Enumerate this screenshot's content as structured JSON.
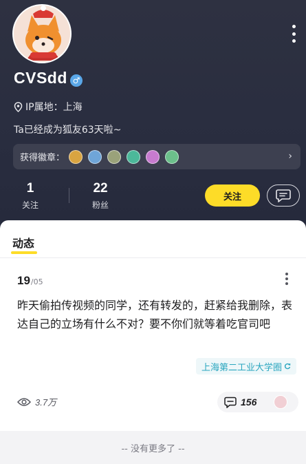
{
  "profile": {
    "avatar_alt": "fox avatar",
    "username": "CVSdd",
    "gender_icon": "♂",
    "ip_location": "IP属地：上海",
    "friend_days": "Ta已经成为狐友63天啦~",
    "badges_label": "获得徽章：",
    "badge_colors": [
      "#d9a441",
      "#6fa5d8",
      "#9aa27a",
      "#4cb89a",
      "#c77bcf",
      "#6cc08b"
    ]
  },
  "stats": {
    "following": {
      "count": "1",
      "label": "关注"
    },
    "followers": {
      "count": "22",
      "label": "粉丝"
    }
  },
  "actions": {
    "follow_label": "关注"
  },
  "tabs": {
    "active_label": "动态"
  },
  "post": {
    "day": "19",
    "month": "/05",
    "text": "昨天偷拍传视频的同学，还有转发的，赶紧给我删除，表达自己的立场有什么不对？要不你们就等着吃官司吧",
    "circle_tag": "上海第二工业大学圈",
    "views": "3.7万",
    "comments": "156"
  },
  "footer": {
    "end_text": "-- 没有更多了 --"
  },
  "colors": {
    "accent": "#fddc28",
    "tag": "#2aa6bf",
    "header_bg": "#2a2e40"
  }
}
